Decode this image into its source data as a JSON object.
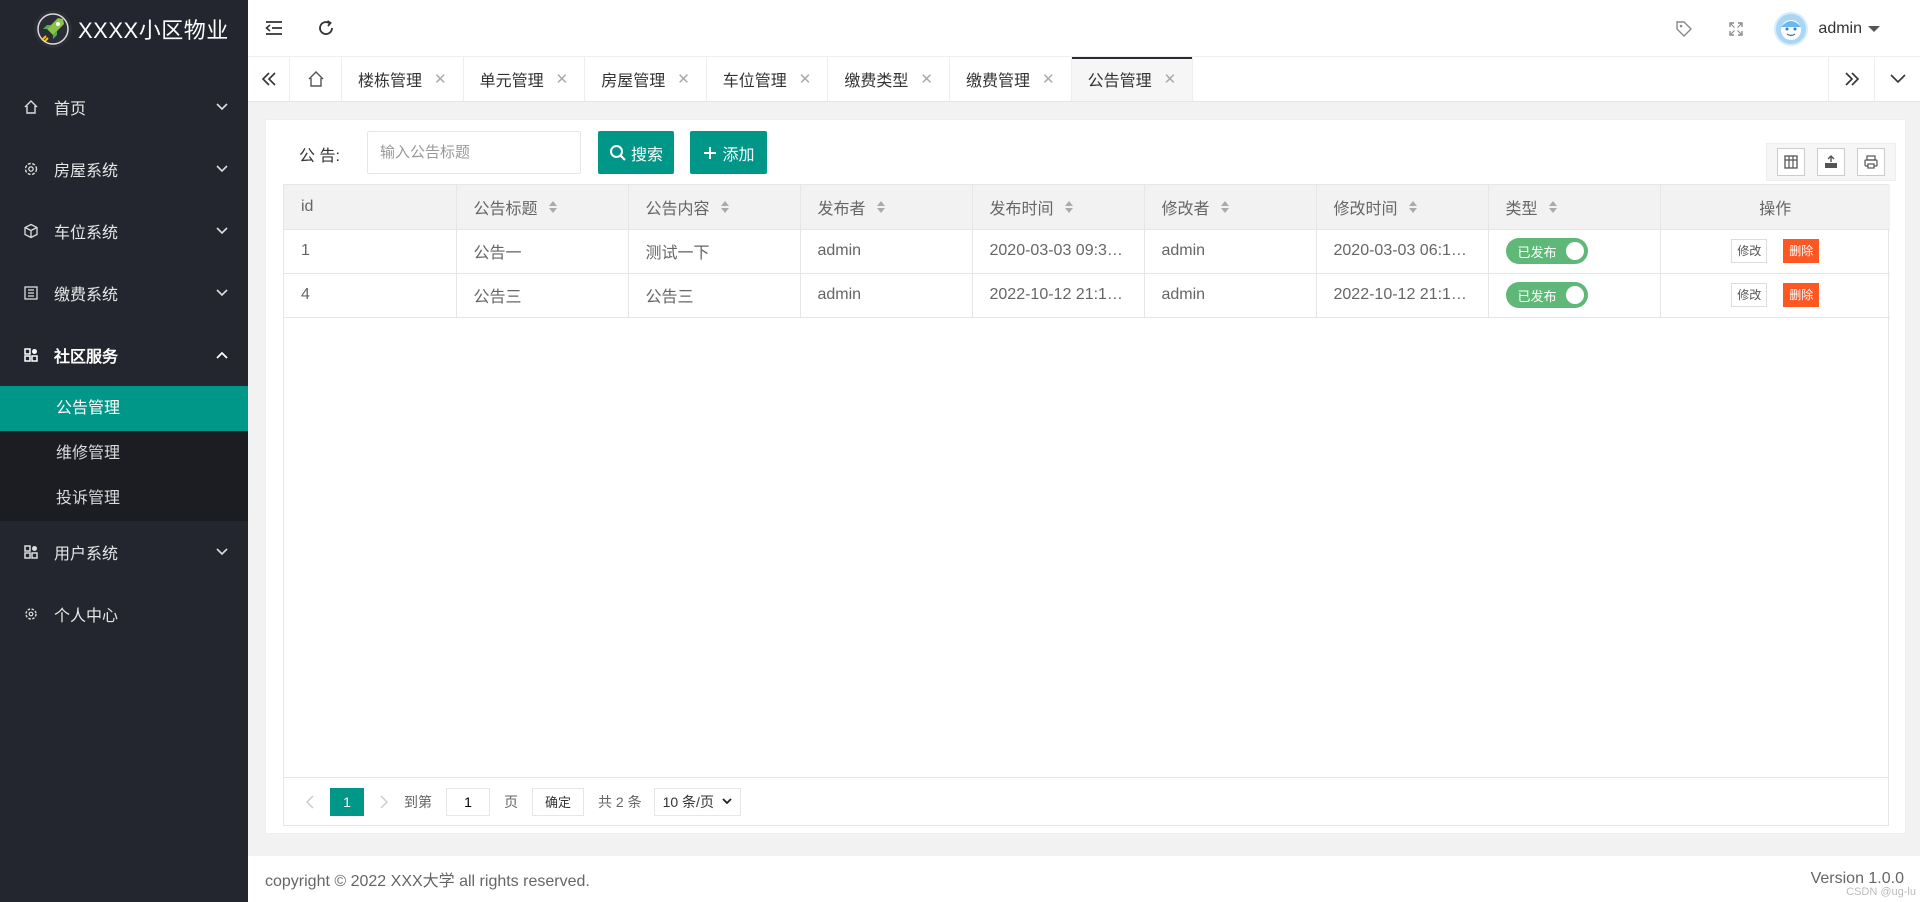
{
  "app": {
    "title": "XXXX小区物业"
  },
  "sidebar": {
    "items": [
      {
        "label": "首页",
        "icon": "home-icon",
        "arrow": "chevron-down"
      },
      {
        "label": "房屋系统",
        "icon": "gear-icon",
        "arrow": "chevron-down"
      },
      {
        "label": "车位系统",
        "icon": "cube-icon",
        "arrow": "chevron-down"
      },
      {
        "label": "缴费系统",
        "icon": "book-icon",
        "arrow": "chevron-down"
      },
      {
        "label": "社区服务",
        "icon": "grid-icon",
        "arrow": "chevron-up"
      }
    ],
    "submenu": [
      {
        "label": "公告管理",
        "active": true
      },
      {
        "label": "维修管理"
      },
      {
        "label": "投诉管理"
      }
    ],
    "items_after": [
      {
        "label": "用户系统",
        "icon": "grid-icon",
        "arrow": "chevron-down"
      },
      {
        "label": "个人中心",
        "icon": "cog-icon"
      }
    ]
  },
  "header": {
    "user_name": "admin"
  },
  "tabs": [
    {
      "label": "楼栋管理"
    },
    {
      "label": "单元管理"
    },
    {
      "label": "房屋管理"
    },
    {
      "label": "车位管理"
    },
    {
      "label": "缴费类型"
    },
    {
      "label": "缴费管理"
    },
    {
      "label": "公告管理",
      "active": true
    }
  ],
  "tab_close_glyph": "✕",
  "search": {
    "label": "公 告:",
    "placeholder": "输入公告标题",
    "search_button": "搜索",
    "add_button": "添加"
  },
  "table": {
    "columns": [
      "id",
      "公告标题",
      "公告内容",
      "发布者",
      "发布时间",
      "修改者",
      "修改时间",
      "类型",
      "操作"
    ],
    "rows": [
      {
        "id": "1",
        "title": "公告一",
        "content": "测试一下",
        "publisher": "admin",
        "publish_time": "2020-03-03 09:3…",
        "modifier": "admin",
        "modify_time": "2020-03-03 06:1…",
        "type": "已发布",
        "edit": "修改",
        "delete": "删除"
      },
      {
        "id": "4",
        "title": "公告三",
        "content": "公告三",
        "publisher": "admin",
        "publish_time": "2022-10-12 21:1…",
        "modifier": "admin",
        "modify_time": "2022-10-12 21:1…",
        "type": "已发布",
        "edit": "修改",
        "delete": "删除"
      }
    ]
  },
  "pager": {
    "current_page": "1",
    "goto_label": "到第",
    "goto_value": "1",
    "page_unit": "页",
    "confirm": "确定",
    "total": "共 2 条",
    "page_size": "10 条/页"
  },
  "footer": {
    "copyright": "copyright © 2022 XXX大学 all rights reserved.",
    "version": "Version 1.0.0",
    "watermark": "CSDN @ug-lu"
  },
  "colors": {
    "accent": "#009688",
    "sidebar_bg": "#23262e",
    "danger": "#ff5722",
    "switch_on": "#5fb878"
  }
}
